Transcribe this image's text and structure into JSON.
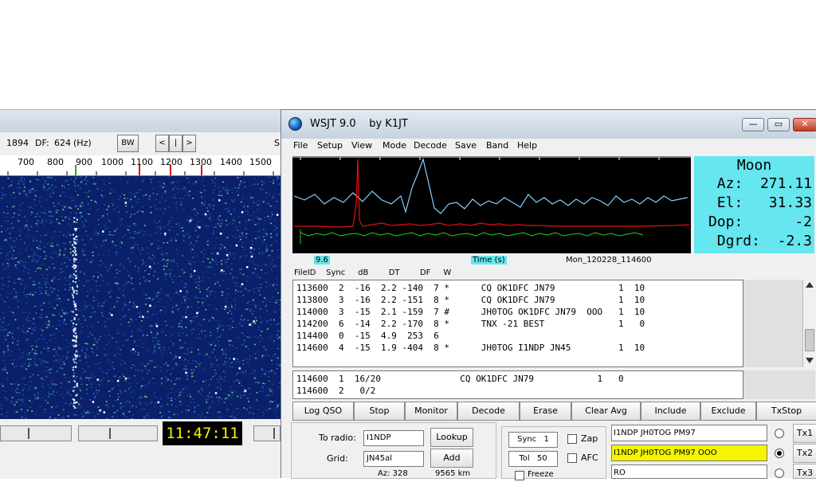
{
  "waterfall": {
    "freq_label": "1894",
    "df_label": "DF:",
    "df_value": "624",
    "df_unit": "(Hz)",
    "bw_button": "BW",
    "nav_left": "<",
    "nav_mid": "|",
    "nav_right": ">",
    "right_edge_char": "S",
    "scale_labels": [
      "700",
      "800",
      "900",
      "1000",
      "1100",
      "1200",
      "1300",
      "1400",
      "1500"
    ],
    "clock": "11:47:11"
  },
  "app": {
    "title": "WSJT 9.0    by K1JT",
    "minimize_symbol": "—",
    "restore_symbol": "▭",
    "close_symbol": "✕"
  },
  "menu": [
    "File",
    "Setup",
    "View",
    "Mode",
    "Decode",
    "Save",
    "Band",
    "Help"
  ],
  "moon": {
    "title": "Moon",
    "az": "Az:  271.11",
    "el": "El:   31.33",
    "dop": "Dop:      -2",
    "dgrd": "Dgrd:  -2.3"
  },
  "plot_footer": {
    "value": "9.6",
    "time_label": "Time (s)",
    "file_stamp": "Mon_120228_114600"
  },
  "columns_header": "FileID    Sync     dB        DT        DF     W",
  "decodes": [
    "113600  2  -16  2.2 -140  7 *      CQ OK1DFC JN79            1  10",
    "113800  3  -16  2.2 -151  8 *      CQ OK1DFC JN79            1  10",
    "114000  3  -15  2.1 -159  7 #      JH0TOG OK1DFC JN79  OOO   1  10",
    "114200  6  -14  2.2 -170  8 *      TNX -21 BEST              1   0",
    "114400  0  -15  4.9  253  6",
    "114600  4  -15  1.9 -404  8 *      JH0TOG I1NDP JN45         1  10"
  ],
  "averages": [
    "114600  1  16/20               CQ OK1DFC JN79            1   0",
    "114600  2   0/2"
  ],
  "buttons": [
    "Log QSO",
    "Stop",
    "Monitor",
    "Decode",
    "Erase",
    "Clear Avg",
    "Include",
    "Exclude",
    "TxStop"
  ],
  "station": {
    "to_radio_label": "To radio:",
    "to_radio_value": "I1NDP",
    "lookup_button": "Lookup",
    "grid_label": "Grid:",
    "grid_value": "JN45al",
    "add_button": "Add",
    "az_partial": "Az: 328",
    "dist_partial": "9565 km"
  },
  "options": {
    "sync_label": "Sync",
    "sync_value": "1",
    "tol_label": "Tol",
    "tol_value": "50",
    "zap_label": "Zap",
    "afc_label": "AFC",
    "freeze_label": "Freeze"
  },
  "tx_messages": [
    {
      "text": "I1NDP JH0TOG PM97",
      "button": "Tx1",
      "selected": false
    },
    {
      "text": "I1NDP JH0TOG PM97 OOO",
      "button": "Tx2",
      "selected": true
    },
    {
      "text": "RO",
      "button": "Tx3",
      "selected": false
    }
  ],
  "colors": {
    "moon_bg": "#66e6ef",
    "tx_highlight": "#f5f500",
    "clock_fg": "#f2f200"
  }
}
